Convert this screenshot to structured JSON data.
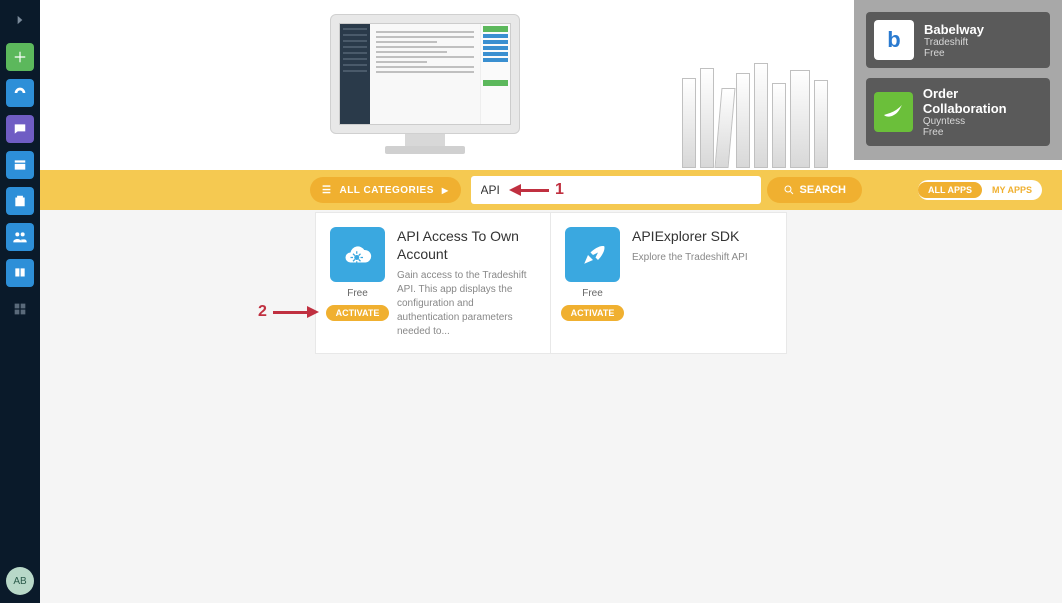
{
  "sidebar": {
    "items": [
      {
        "name": "add"
      },
      {
        "name": "dashboard"
      },
      {
        "name": "messages"
      },
      {
        "name": "inbox"
      },
      {
        "name": "clipboard"
      },
      {
        "name": "contacts"
      },
      {
        "name": "docs"
      },
      {
        "name": "apps"
      }
    ],
    "avatar": "AB"
  },
  "promos": [
    {
      "title": "Babelway",
      "vendor": "Tradeshift",
      "price": "Free",
      "icon_char": "b",
      "icon_style": "white"
    },
    {
      "title": "Order Collaboration",
      "vendor": "Quyntess",
      "price": "Free",
      "icon_char": "≈",
      "icon_style": "green"
    }
  ],
  "search": {
    "category_label": "ALL CATEGORIES",
    "input_value": "API",
    "button_label": "SEARCH",
    "toggle_all": "ALL APPS",
    "toggle_my": "MY APPS"
  },
  "results": [
    {
      "title": "API Access To Own Account",
      "desc": "Gain access to the Tradeshift API. This app displays the configuration and authentication parameters needed to...",
      "price": "Free",
      "action": "ACTIVATE",
      "icon": "cloud"
    },
    {
      "title": "APIExplorer SDK",
      "desc": "Explore the Tradeshift API",
      "price": "Free",
      "action": "ACTIVATE",
      "icon": "rocket"
    }
  ],
  "annotations": {
    "one": "1",
    "two": "2"
  }
}
